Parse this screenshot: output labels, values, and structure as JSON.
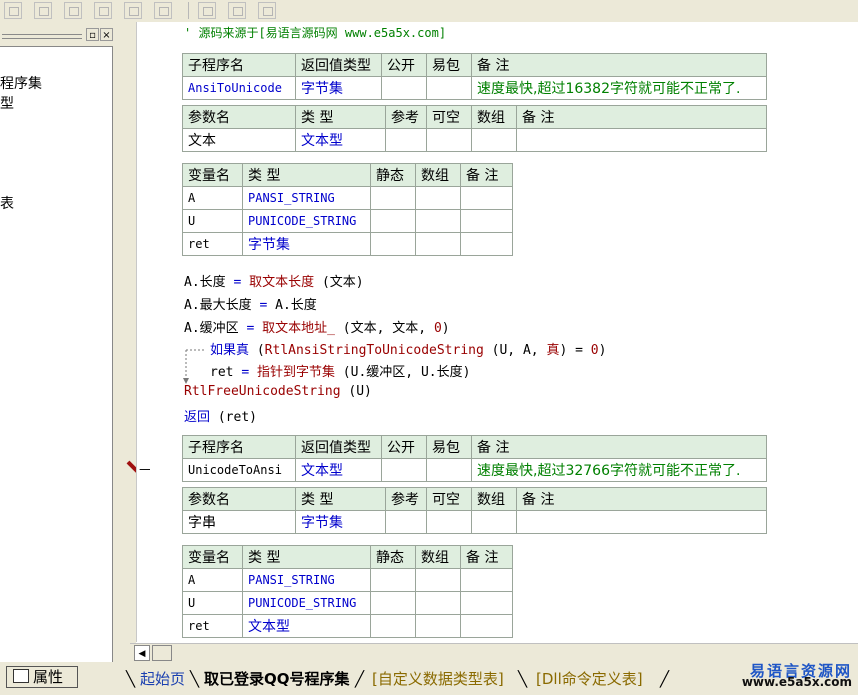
{
  "toolbar": {
    "buttons": [
      "align-left-icon",
      "align-center-icon",
      "align-top-icon",
      "align-middle-icon",
      "space-horizontal-icon",
      "space-vertical-icon",
      "same-width-icon",
      "same-height-icon",
      "same-size-icon"
    ]
  },
  "left_panel": {
    "close_label": "×",
    "restore_label": "▫",
    "tree_items": [
      "程序集",
      "型",
      "表"
    ]
  },
  "code": {
    "comment": "' 源码来源于[易语言源码网 www.e5a5x.com]",
    "sub1": {
      "headers": [
        "子程序名",
        "返回值类型",
        "公开",
        "易包",
        "备 注"
      ],
      "name": "AnsiToUnicode",
      "return_type": "字节集",
      "public": "",
      "easy_pack": "",
      "remark": "速度最快,超过16382字符就可能不正常了.",
      "param_headers": [
        "参数名",
        "类 型",
        "参考",
        "可空",
        "数组",
        "备 注"
      ],
      "params": [
        {
          "name": "文本",
          "type": "文本型",
          "ref": "",
          "nullable": "",
          "array": "",
          "remark": ""
        }
      ],
      "var_headers": [
        "变量名",
        "类 型",
        "静态",
        "数组",
        "备 注"
      ],
      "vars": [
        {
          "name": "A",
          "type": "PANSI_STRING"
        },
        {
          "name": "U",
          "type": "PUNICODE_STRING"
        },
        {
          "name": "ret",
          "type": "字节集"
        }
      ]
    },
    "lines": {
      "l1_a": "A.长度 ",
      "l1_eq": "= ",
      "l1_fn": "取文本长度",
      "l1_arg": " (文本)",
      "l2_a": "A.最大长度 ",
      "l2_eq": "= ",
      "l2_b": "A.长度",
      "l3_a": "A.缓冲区 ",
      "l3_eq": "= ",
      "l3_fn": "取文本地址_",
      "l3_arg": " (文本, 文本, ",
      "l3_num": "0",
      "l3_end": ")",
      "l4_kw": "如果真",
      "l4_open": " (",
      "l4_fn": "RtlAnsiStringToUnicodeString",
      "l4_arg": " (U, A, ",
      "l4_true": "真",
      "l4_close": ") = ",
      "l4_num": "0",
      "l4_end": ")",
      "l5_a": "ret ",
      "l5_eq": "= ",
      "l5_fn": "指针到字节集",
      "l5_arg": " (U.缓冲区, U.长度)",
      "l6_fn": "RtlFreeUnicodeString",
      "l6_arg": " (U)",
      "l7_kw": "返回",
      "l7_arg": " (ret)"
    },
    "sub2": {
      "headers": [
        "子程序名",
        "返回值类型",
        "公开",
        "易包",
        "备 注"
      ],
      "name": "UnicodeToAnsi",
      "return_type": "文本型",
      "public": "",
      "easy_pack": "",
      "remark": "速度最快,超过32766字符就可能不正常了.",
      "param_headers": [
        "参数名",
        "类 型",
        "参考",
        "可空",
        "数组",
        "备 注"
      ],
      "params": [
        {
          "name": "字串",
          "type": "字节集",
          "ref": "",
          "nullable": "",
          "array": "",
          "remark": ""
        }
      ],
      "var_headers": [
        "变量名",
        "类 型",
        "静态",
        "数组",
        "备 注"
      ],
      "vars": [
        {
          "name": "A",
          "type": "PANSI_STRING"
        },
        {
          "name": "U",
          "type": "PUNICODE_STRING"
        },
        {
          "name": "ret",
          "type": "文本型"
        }
      ]
    },
    "current_marker": "—"
  },
  "bottom": {
    "props_label": "属性",
    "tabs": [
      "起始页",
      "取已登录QQ号程序集",
      "[自定义数据类型表]",
      "[Dll命令定义表]"
    ],
    "active_tab_index": 1,
    "brand_cn": "易语言资源网",
    "brand_url": "www.e5a5x.com"
  },
  "colors": {
    "keyword_blue": "#0000cc",
    "remark_green": "#008000",
    "function_red": "#990000",
    "header_bg": "#dfeedf"
  }
}
